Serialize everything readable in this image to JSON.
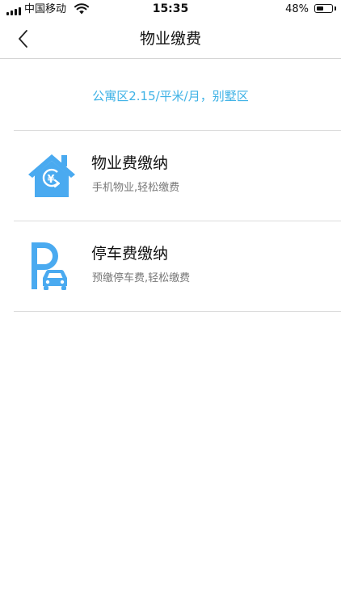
{
  "status_bar": {
    "carrier": "中国移动",
    "time": "15:35",
    "battery_percent": "48%",
    "battery_level": 0.48
  },
  "nav": {
    "back_icon": "chevron-left-icon",
    "title": "物业缴费"
  },
  "fee_note": "公寓区2.15/平米/月，别墅区",
  "menu": [
    {
      "icon": "house-yen-icon",
      "title": "物业费缴纳",
      "subtitle": "手机物业,轻松缴费"
    },
    {
      "icon": "parking-car-icon",
      "title": "停车费缴纳",
      "subtitle": "预缴停车费,轻松缴费"
    }
  ],
  "colors": {
    "accent": "#3eb2e6",
    "icon_blue": "#4aaaf0",
    "divider": "#dcdcdc"
  }
}
